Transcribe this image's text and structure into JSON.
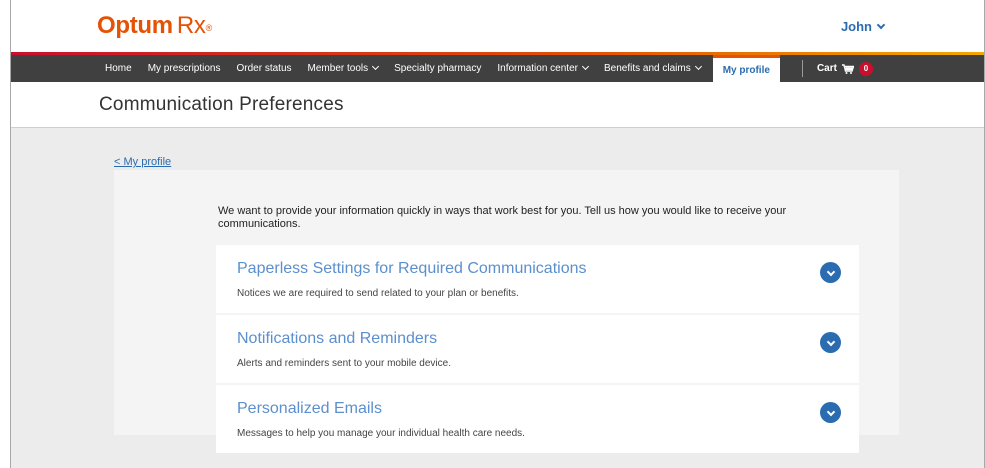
{
  "brand": {
    "name_bold": "Optum",
    "name_light": "Rx",
    "mark": "®",
    "color": "#e35205"
  },
  "user": {
    "name": "John"
  },
  "nav": {
    "items": [
      {
        "label": "Home"
      },
      {
        "label": "My prescriptions"
      },
      {
        "label": "Order status"
      },
      {
        "label": "Member tools"
      },
      {
        "label": "Specialty pharmacy"
      },
      {
        "label": "Information center"
      },
      {
        "label": "Benefits and claims"
      },
      {
        "label": "My profile"
      }
    ],
    "cart_label": "Cart",
    "cart_count": "0"
  },
  "page": {
    "title": "Communication Preferences"
  },
  "back_link": "< My profile",
  "intro": "We want to provide your information quickly in ways that work best for you. Tell us how you would like to receive your communications.",
  "cards": [
    {
      "title": "Paperless Settings for Required Communications",
      "desc": "Notices we are required to send related to your plan or benefits."
    },
    {
      "title": "Notifications and Reminders",
      "desc": "Alerts and reminders sent to your mobile device."
    },
    {
      "title": "Personalized Emails",
      "desc": "Messages to help you manage your individual health care needs."
    }
  ],
  "colors": {
    "accent_blue": "#2b6cb0",
    "nav_bg": "#404040",
    "badge": "#c8102e"
  },
  "icons": {
    "user_menu": "chevron-down-icon",
    "cart": "cart-icon",
    "expand": "chevron-down-icon"
  }
}
